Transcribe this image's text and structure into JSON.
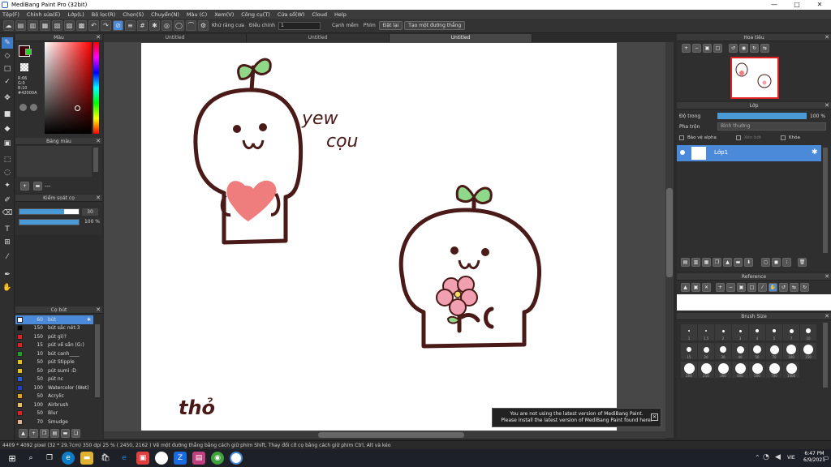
{
  "window": {
    "title": "MediBang Paint Pro (32bit)",
    "min": "—",
    "max": "□",
    "close": "✕"
  },
  "menu": [
    "Tệp(F)",
    "Chỉnh sửa(E)",
    "Lớp(L)",
    "Bộ lọc(R)",
    "Chọn(S)",
    "Chuyển(N)",
    "Màu (C)",
    "Xem(V)",
    "Công cụ(T)",
    "Cửa sổ(W)",
    "Cloud",
    "Help"
  ],
  "toolbar": {
    "aa_label": "Khử răng cưa",
    "correction_label": "Điều chỉnh",
    "correction_value": "1",
    "edge_label": "Cạnh mềm",
    "snap_label": "Phím",
    "snap_off": "Đặt lại",
    "create_line": "Tạo một đường thẳng"
  },
  "tabs": [
    "Untitled",
    "Untitled",
    "Untitled"
  ],
  "color_panel": {
    "title": "Màu",
    "r": "R:66",
    "g": "G:0",
    "b": "B:10",
    "hex": "#42000A",
    "primary": "#42000a"
  },
  "swatch_panel": {
    "title": "Bảng màu",
    "more": "---"
  },
  "brush_control": {
    "title": "Kiểm soát cọ",
    "size": "30",
    "opacity": "100 %"
  },
  "brush_list": {
    "title": "Cọ bút",
    "items": [
      {
        "size": "60",
        "name": "bút",
        "color": "#ffffff",
        "selected": true
      },
      {
        "size": "150",
        "name": "bút sắc nét:3",
        "color": "#000000"
      },
      {
        "size": "150",
        "name": "pút gì)?",
        "color": "#e02020"
      },
      {
        "size": "15",
        "name": "pút vẽ sần (G:)",
        "color": "#e02020"
      },
      {
        "size": "10",
        "name": "bút canh____",
        "color": "#20a020"
      },
      {
        "size": "50",
        "name": "pút Stipple",
        "color": "#e0c020"
      },
      {
        "size": "50",
        "name": "pút sumi :D",
        "color": "#e0c020"
      },
      {
        "size": "50",
        "name": "pút nc",
        "color": "#2060e0"
      },
      {
        "size": "100",
        "name": "Watercolor (Wet)",
        "color": "#2040d0"
      },
      {
        "size": "50",
        "name": "Acrylic",
        "color": "#e0a020"
      },
      {
        "size": "100",
        "name": "Airbrush",
        "color": "#e0c060"
      },
      {
        "size": "50",
        "name": "Blur",
        "color": "#e02020"
      },
      {
        "size": "70",
        "name": "Smudge",
        "color": "#e0b090"
      }
    ]
  },
  "navigator": {
    "title": "Hoa tiêu"
  },
  "layer_panel": {
    "title": "Lớp",
    "opacity_label": "Độ trong",
    "opacity_value": "100 %",
    "blend_label": "Pha trộn",
    "blend_value": "Bình thường",
    "protect_alpha": "Bảo vệ alpha",
    "clip": "Xén bớt",
    "lock": "Khóa",
    "layer_name": "Lớp1"
  },
  "reference": {
    "title": "Reference"
  },
  "brush_size": {
    "title": "Brush Size",
    "row1": [
      "1",
      "1.5",
      "2",
      "3",
      "4",
      "5",
      "7",
      "10"
    ],
    "row2": [
      "15",
      "20",
      "30",
      "40",
      "50",
      "70",
      "100",
      "150"
    ],
    "row3": [
      "200",
      "250",
      "300",
      "400",
      "500",
      "700",
      "1000"
    ]
  },
  "canvas_text": {
    "yew": "yew",
    "cou": "cọu",
    "tho": "thỏ"
  },
  "notification": {
    "line1": "You are not using the latest version of MediBang Paint.",
    "line2": "Please install the latest version of MediBang Paint found here.",
    "close": "✕"
  },
  "status": "4409 * 4092 pixel  (32 * 29.7cm)  350 dpi  25 %  ( 2450, 2162 )  Vẽ một đường thẳng bằng cách giữ phím Shift, Thay đổi cỡ cọ bằng cách giữ phím Ctrl, Alt và kéo",
  "taskbar": {
    "lang": "VIE",
    "time": "6:47 PM",
    "date": "6/9/2021"
  }
}
